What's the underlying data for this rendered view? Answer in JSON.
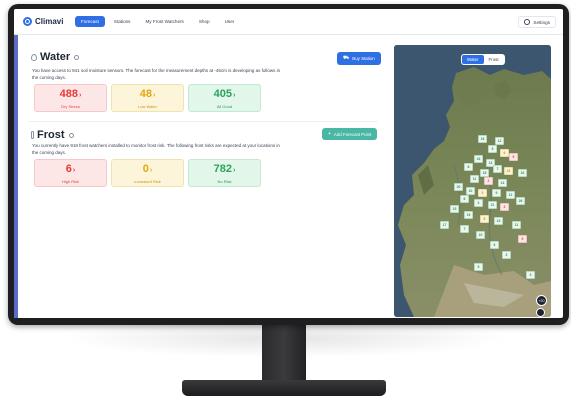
{
  "app": {
    "logo_text": "Climavi"
  },
  "nav": {
    "tabs": [
      {
        "label": "Forecast",
        "active": true
      },
      {
        "label": "Stations",
        "active": false
      },
      {
        "label": "My Frost Watchers",
        "active": false
      },
      {
        "label": "Shop",
        "active": false
      },
      {
        "label": "User",
        "active": false
      }
    ],
    "settings_label": "Settings"
  },
  "water": {
    "title": "Water",
    "button_label": "Buy Station",
    "description": "You have access to 941 soil moisture sensors. The forecast for the measurement depths at -45cm is developing as follows in the coming days.",
    "cards": [
      {
        "value": "488",
        "label": "Dry Stress",
        "tone": "red"
      },
      {
        "value": "48",
        "label": "Low Water",
        "tone": "yellow"
      },
      {
        "value": "405",
        "label": "All Good",
        "tone": "green"
      }
    ]
  },
  "frost": {
    "title": "Frost",
    "button_label": "Add Forecast Point",
    "description": "You currently have 918 frost watchers installed to monitor frost risk. The following frost risks are expected at your locations in the coming days.",
    "cards": [
      {
        "value": "6",
        "label": "High Risk",
        "tone": "red"
      },
      {
        "value": "0",
        "label": "Increased Risk",
        "tone": "yellow"
      },
      {
        "value": "782",
        "label": "No Risk",
        "tone": "green"
      }
    ]
  },
  "map": {
    "toggle": [
      {
        "label": "Water",
        "active": true
      },
      {
        "label": "Frost",
        "active": false
      }
    ],
    "markers": [
      {
        "label": "16",
        "tone": "green"
      },
      {
        "label": "5",
        "tone": "green"
      },
      {
        "label": "12",
        "tone": "green"
      },
      {
        "label": "6",
        "tone": "yellow"
      },
      {
        "label": "24",
        "tone": "green"
      },
      {
        "label": "13",
        "tone": "green"
      },
      {
        "label": "9",
        "tone": "red"
      },
      {
        "label": "8",
        "tone": "green"
      },
      {
        "label": "18",
        "tone": "green"
      },
      {
        "label": "7",
        "tone": "green"
      },
      {
        "label": "22",
        "tone": "yellow"
      },
      {
        "label": "34",
        "tone": "green"
      },
      {
        "label": "11",
        "tone": "green"
      },
      {
        "label": "2",
        "tone": "red"
      },
      {
        "label": "14",
        "tone": "green"
      },
      {
        "label": "20",
        "tone": "green"
      },
      {
        "label": "10",
        "tone": "green"
      },
      {
        "label": "5",
        "tone": "yellow"
      },
      {
        "label": "9",
        "tone": "green"
      },
      {
        "label": "12",
        "tone": "green"
      },
      {
        "label": "6",
        "tone": "green"
      },
      {
        "label": "4",
        "tone": "green"
      },
      {
        "label": "21",
        "tone": "green"
      },
      {
        "label": "3",
        "tone": "red"
      },
      {
        "label": "26",
        "tone": "green"
      },
      {
        "label": "15",
        "tone": "green"
      },
      {
        "label": "19",
        "tone": "green"
      },
      {
        "label": "8",
        "tone": "yellow"
      },
      {
        "label": "13",
        "tone": "green"
      },
      {
        "label": "11",
        "tone": "green"
      },
      {
        "label": "17",
        "tone": "green"
      },
      {
        "label": "7",
        "tone": "green"
      },
      {
        "label": "10",
        "tone": "green"
      },
      {
        "label": "5",
        "tone": "red"
      },
      {
        "label": "6",
        "tone": "green"
      },
      {
        "label": "2",
        "tone": "green"
      },
      {
        "label": "9",
        "tone": "green"
      },
      {
        "label": "3",
        "tone": "green"
      }
    ],
    "zoom_label": "+20"
  }
}
